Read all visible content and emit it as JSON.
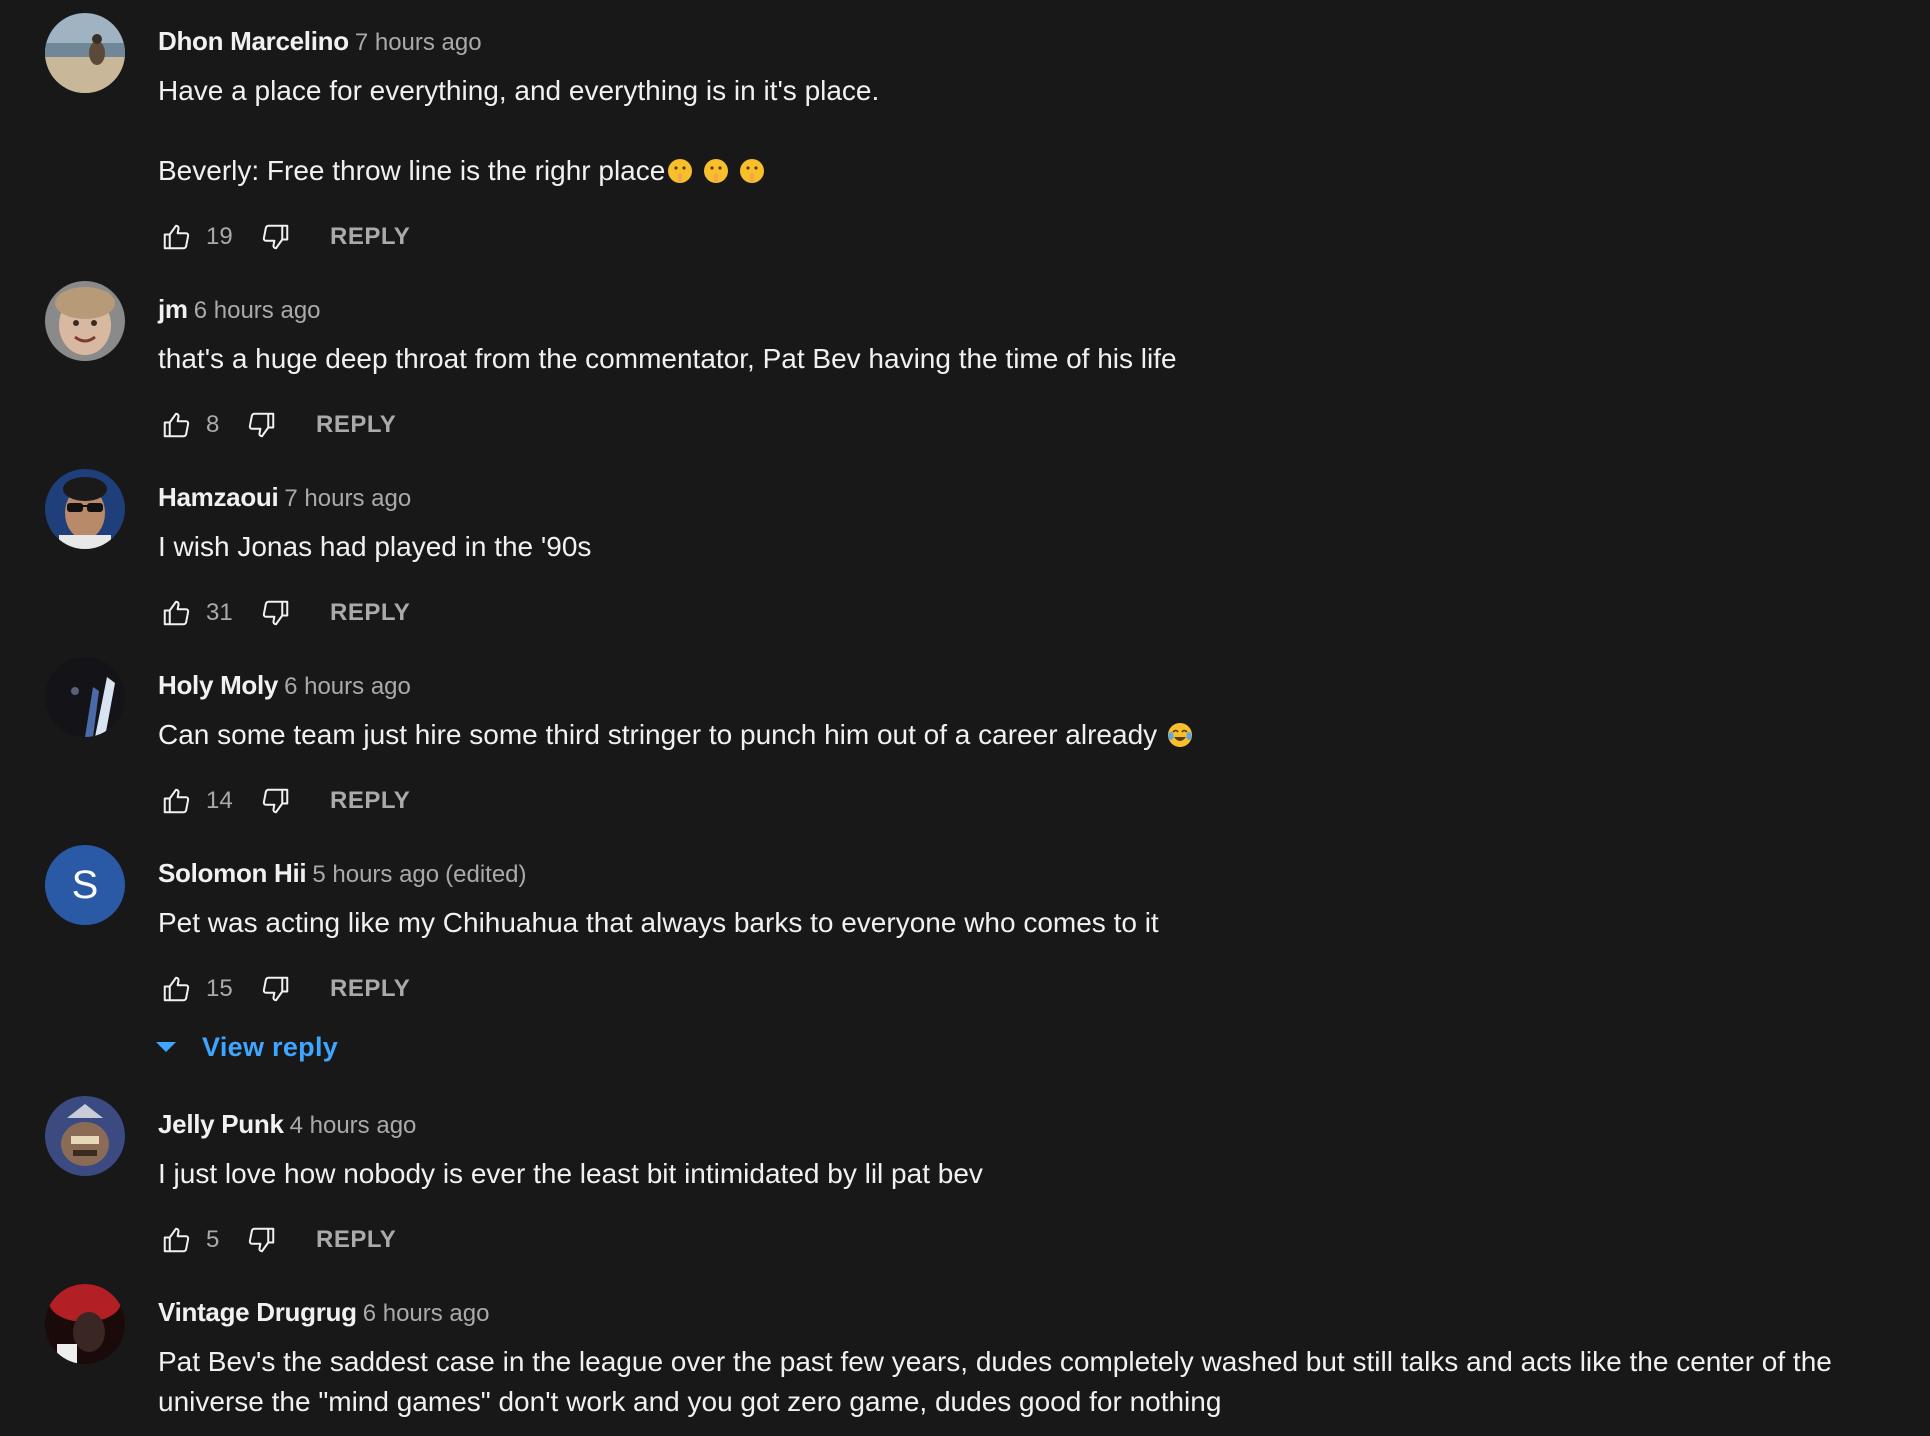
{
  "comments": [
    {
      "author": "Dhon Marcelino",
      "time": "7 hours ago",
      "text": "Have a place for everything, and everything is in it's place.\n\nBeverly: Free throw line is the righr place",
      "emojis": [
        "shushing-face",
        "shushing-face",
        "shushing-face"
      ],
      "likes": "19",
      "avatar": "photo-beach"
    },
    {
      "author": "jm",
      "time": "6 hours ago",
      "text": "that's a huge deep throat from the commentator, Pat Bev having the time of his life",
      "likes": "8",
      "avatar": "photo-face"
    },
    {
      "author": "Hamzaoui",
      "time": "7 hours ago",
      "text": "I wish Jonas had played in the '90s",
      "likes": "31",
      "avatar": "photo-sunglasses"
    },
    {
      "author": "Holy Moly",
      "time": "6 hours ago",
      "text": "Can some team just hire some third stringer to punch him out of a career already",
      "emojis": [
        "tears-of-joy"
      ],
      "likes": "14",
      "avatar": "photo-dark-anime"
    },
    {
      "author": "Solomon Hii",
      "time": "5 hours ago",
      "edited": "(edited)",
      "text": "Pet was acting like my Chihuahua that always barks to everyone who comes to it",
      "likes": "15",
      "avatar_letter": "S",
      "view_reply": "View reply"
    },
    {
      "author": "Jelly Punk",
      "time": "4 hours ago",
      "text": "I just love how nobody is ever the least bit intimidated by lil pat bev",
      "likes": "5",
      "avatar": "photo-cartoon"
    },
    {
      "author": "Vintage Drugrug",
      "time": "6 hours ago",
      "text": "Pat Bev's the saddest case in the league over the past few years, dudes completely washed but still talks and acts like the center of the universe the \"mind games\" don't work and you got zero game, dudes good for nothing",
      "avatar": "photo-red"
    }
  ],
  "labels": {
    "reply": "REPLY"
  },
  "colors": {
    "background": "#181818",
    "text": "#f1f1f1",
    "secondary": "#aaaaaa",
    "link": "#3ea6ff",
    "avatar_letter_bg": "#2a5aa6"
  }
}
